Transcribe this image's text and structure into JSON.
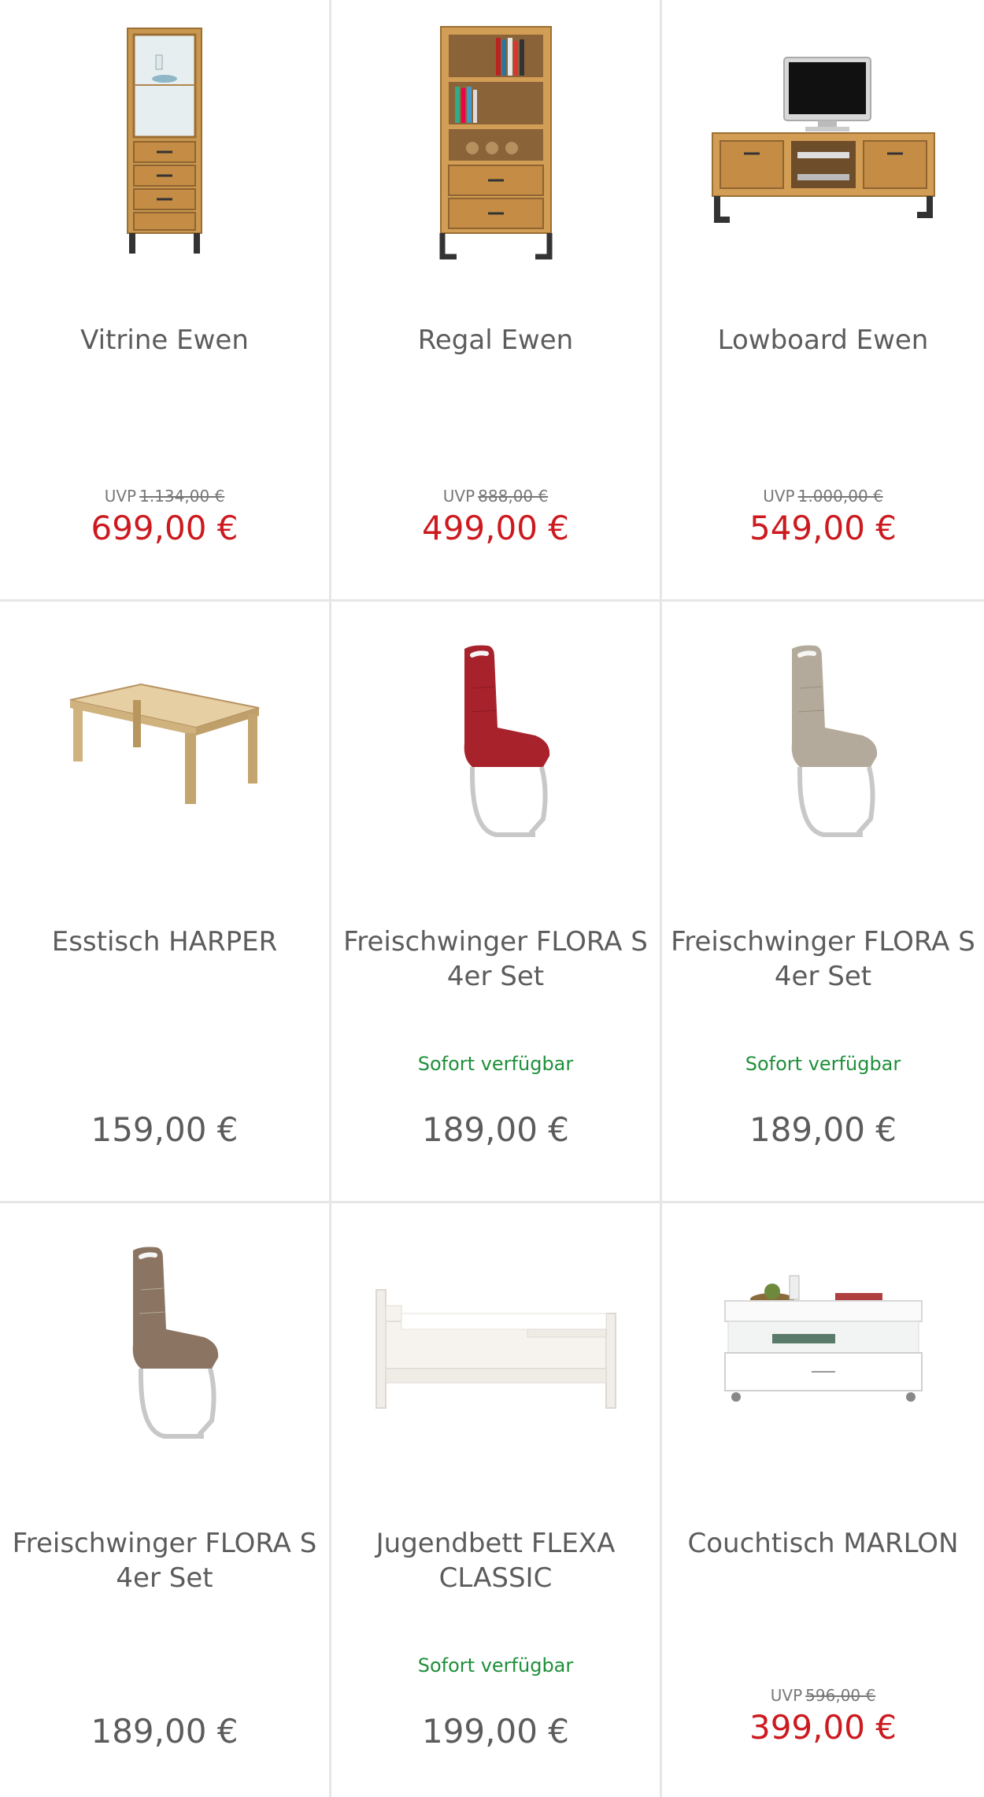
{
  "products": [
    {
      "title": "Vitrine Ewen",
      "uvp_label": "UVP",
      "uvp_price": "1.134,00 €",
      "price": "699,00 €",
      "availability": ""
    },
    {
      "title": "Regal Ewen",
      "uvp_label": "UVP",
      "uvp_price": "888,00 €",
      "price": "499,00 €",
      "availability": ""
    },
    {
      "title": "Lowboard Ewen",
      "uvp_label": "UVP",
      "uvp_price": "1.000,00 €",
      "price": "549,00 €",
      "availability": ""
    },
    {
      "title": "Esstisch HARPER",
      "uvp_label": "",
      "uvp_price": "",
      "price": "159,00 €",
      "availability": ""
    },
    {
      "title": "Freischwinger FLORA S 4er Set",
      "uvp_label": "",
      "uvp_price": "",
      "price": "189,00 €",
      "availability": "Sofort verfügbar"
    },
    {
      "title": "Freischwinger FLORA S 4er Set",
      "uvp_label": "",
      "uvp_price": "",
      "price": "189,00 €",
      "availability": "Sofort verfügbar"
    },
    {
      "title": "Freischwinger FLORA S 4er Set",
      "uvp_label": "",
      "uvp_price": "",
      "price": "189,00 €",
      "availability": ""
    },
    {
      "title": "Jugendbett FLEXA CLASSIC",
      "uvp_label": "",
      "uvp_price": "",
      "price": "199,00 €",
      "availability": "Sofort verfügbar"
    },
    {
      "title": "Couchtisch MARLON",
      "uvp_label": "UVP",
      "uvp_price": "596,00 €",
      "price": "399,00 €",
      "availability": ""
    }
  ],
  "colors": {
    "sale_price": "#cc1a1f",
    "regular_price": "#5c5c5c",
    "availability": "#1f8f3a",
    "divider": "#e6e6e6"
  }
}
